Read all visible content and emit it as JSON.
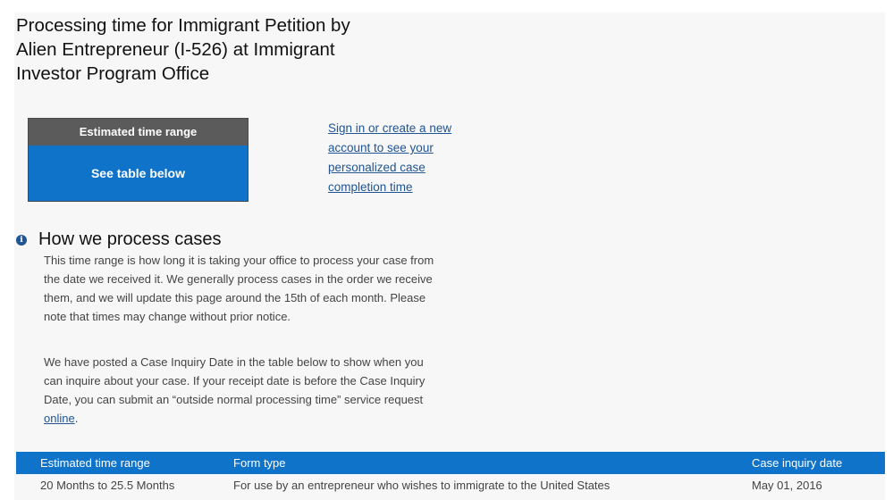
{
  "page": {
    "title": "Processing time for Immigrant Petition by Alien Entrepreneur (I-526) at Immigrant Investor Program Office"
  },
  "estimate_box": {
    "header": "Estimated time range",
    "value": "See table below"
  },
  "signin_link": "Sign in or create a new account to see your personalized case completion time",
  "how_section": {
    "icon": "info-icon",
    "title": "How we process cases",
    "paragraph1": "This time range is how long it is taking your office to process your case from the date we received it. We generally process cases in the order we receive them, and we will update this page around the 15th of each month. Please note that times may change without prior notice.",
    "paragraph2_prefix": "We have posted a Case Inquiry Date in the table below to show when you can inquire about your case. If your receipt date is before the Case Inquiry Date, you can submit an “outside normal processing time” service request ",
    "paragraph2_link": "online",
    "paragraph2_suffix": "."
  },
  "table": {
    "headers": [
      "Estimated time range",
      "Form type",
      "Case inquiry date"
    ],
    "rows": [
      [
        "20 Months to 25.5 Months",
        "For use by an entrepreneur who wishes to immigrate to the United States",
        "May 01, 2016"
      ]
    ]
  },
  "colors": {
    "accent_blue": "#0f73c9",
    "link_blue": "#205493",
    "header_gray": "#5b5b5b"
  }
}
